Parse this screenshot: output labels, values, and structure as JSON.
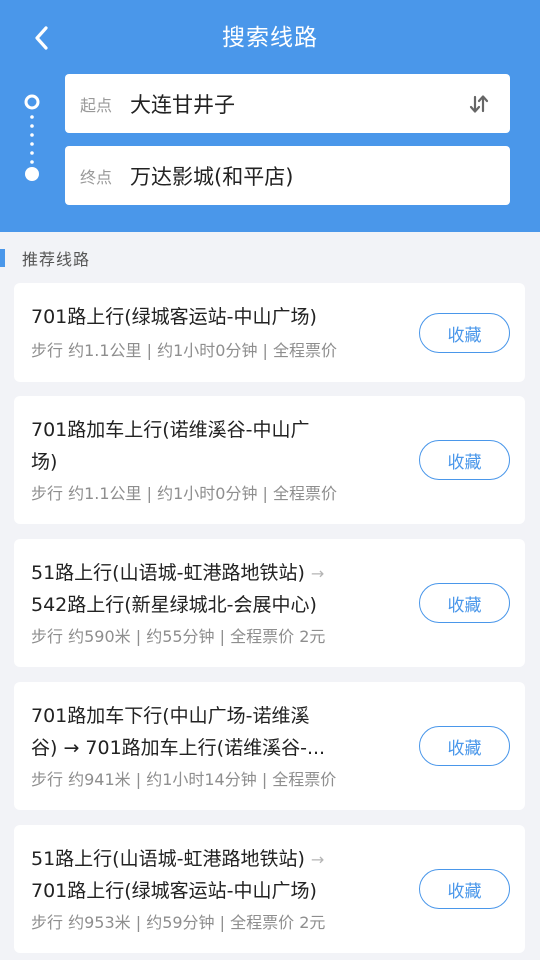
{
  "header": {
    "title": "搜索线路",
    "back_icon": "chevron-left-icon"
  },
  "search": {
    "start_label": "起点",
    "start_value": "大连甘井子",
    "end_label": "终点",
    "end_value": "万达影城(和平店)",
    "swap_icon": "swap-vertical-icon"
  },
  "section": {
    "title": "推荐线路"
  },
  "routes": [
    {
      "line1": "701路上行(绿城客运站-中山广场)",
      "line2": "",
      "summary": "步行 约1.1公里 | 约1小时0分钟 | 全程票价",
      "fav_label": "收藏"
    },
    {
      "line1": "701路加车上行(诺维溪谷-中山广",
      "line2": "场)",
      "summary": "步行 约1.1公里 | 约1小时0分钟 | 全程票价",
      "fav_label": "收藏"
    },
    {
      "line1": "51路上行(山语城-虹港路地铁站)",
      "line1_arrow": "→",
      "line2": "542路上行(新星绿城北-会展中心)",
      "summary": "步行 约590米 | 约55分钟 | 全程票价 2元",
      "fav_label": "收藏"
    },
    {
      "line1": "701路加车下行(中山广场-诺维溪",
      "line2": "谷) → 701路加车上行(诺维溪谷-...",
      "summary": "步行 约941米 | 约1小时14分钟 | 全程票价",
      "fav_label": "收藏"
    },
    {
      "line1": "51路上行(山语城-虹港路地铁站)",
      "line1_arrow": "→",
      "line2": "701路上行(绿城客运站-中山广场)",
      "summary": "步行 约953米 | 约59分钟 | 全程票价 2元",
      "fav_label": "收藏"
    }
  ],
  "colors": {
    "primary": "#4a97ea",
    "background": "#f2f3f7"
  }
}
